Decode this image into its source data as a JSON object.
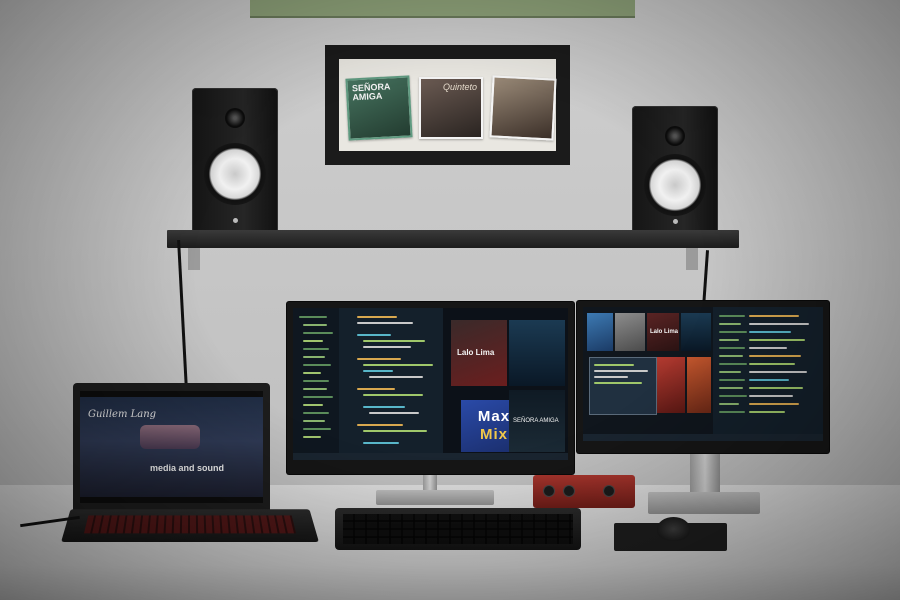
{
  "scene": {
    "wall_color": "#c9c9c9",
    "desk_color": "#d6d6d6",
    "accent_red": "#a6342c"
  },
  "frame": {
    "album_1_text": "SEÑORA AMIGA",
    "album_2_text": "Quinteto",
    "album_3_text": ""
  },
  "monitor_center": {
    "tile_title_1": "Lalo Lima",
    "tile_title_2": "Max",
    "tile_title_3": "Mix",
    "tile_brand": "SEÑORA AMIGA"
  },
  "monitor_right": {
    "tile_title": "Lalo Lima"
  },
  "laptop": {
    "site_title": "Guillem Lang",
    "site_heading": "media and sound"
  }
}
